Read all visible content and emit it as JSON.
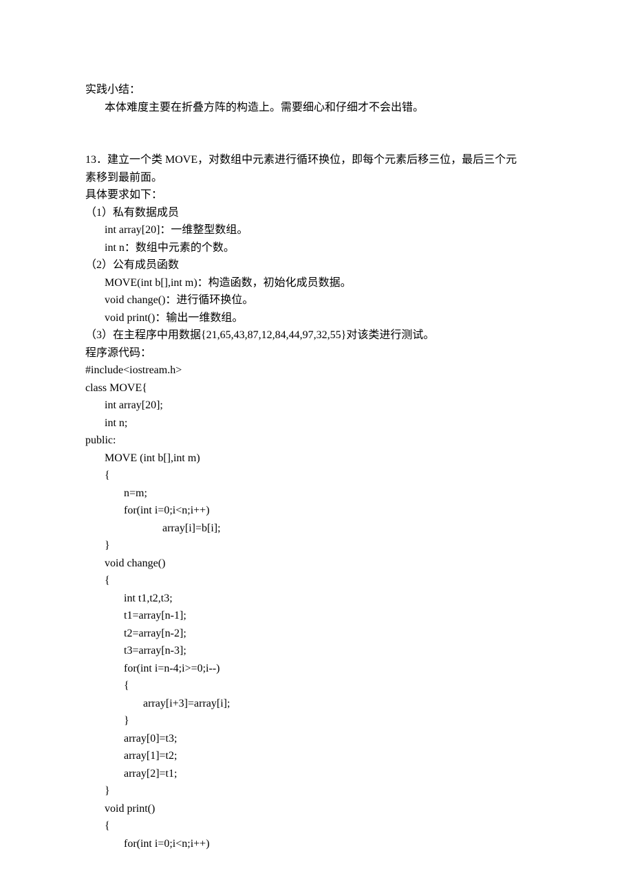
{
  "line1": "实践小结：",
  "line2": "       本体难度主要在折叠方阵的构造上。需要细心和仔细才不会出错。",
  "line3a": "13．建立一个类 MOVE，对数组中元素进行循环换位，即每个元素后移三位，最后三个元",
  "line3b": "素移到最前面。",
  "line4": "具体要求如下：",
  "line5": "（1）私有数据成员",
  "bullet": "",
  "bul1": "int array[20]：一维整型数组。",
  "bul2": "int n：数组中元素的个数。",
  "line6": "（2）公有成员函数",
  "bul3": "MOVE(int b[],int m)：构造函数，初始化成员数据。",
  "bul4": "void change()：进行循环换位。",
  "bul5": "void print()：输出一维数组。",
  "line7": "（3）在主程序中用数据{21,65,43,87,12,84,44,97,32,55}对该类进行测试。",
  "line8": "程序源代码：",
  "code1": "#include<iostream.h>",
  "code2": "class MOVE{",
  "code3": "       int array[20];",
  "code4": "       int n;",
  "code5": "public:",
  "code6": "       MOVE (int b[],int m)",
  "code7": "       {",
  "code8": "              n=m;",
  "code9": "              for(int i=0;i<n;i++)",
  "code10": "                            array[i]=b[i];",
  "code11": "       }",
  "code12": "       void change()",
  "code13": "       {",
  "code14": "              int t1,t2,t3;",
  "code15": "              t1=array[n-1];",
  "code16": "              t2=array[n-2];",
  "code17": "              t3=array[n-3];",
  "code18": "              for(int i=n-4;i>=0;i--)",
  "code19": "              {",
  "code20": "                     array[i+3]=array[i];",
  "code21": "              }",
  "code22": "              array[0]=t3;",
  "code23": "              array[1]=t2;",
  "code24": "              array[2]=t1;",
  "code25": "       }",
  "code26": "       void print()",
  "code27": "       {",
  "code28": "              for(int i=0;i<n;i++)"
}
